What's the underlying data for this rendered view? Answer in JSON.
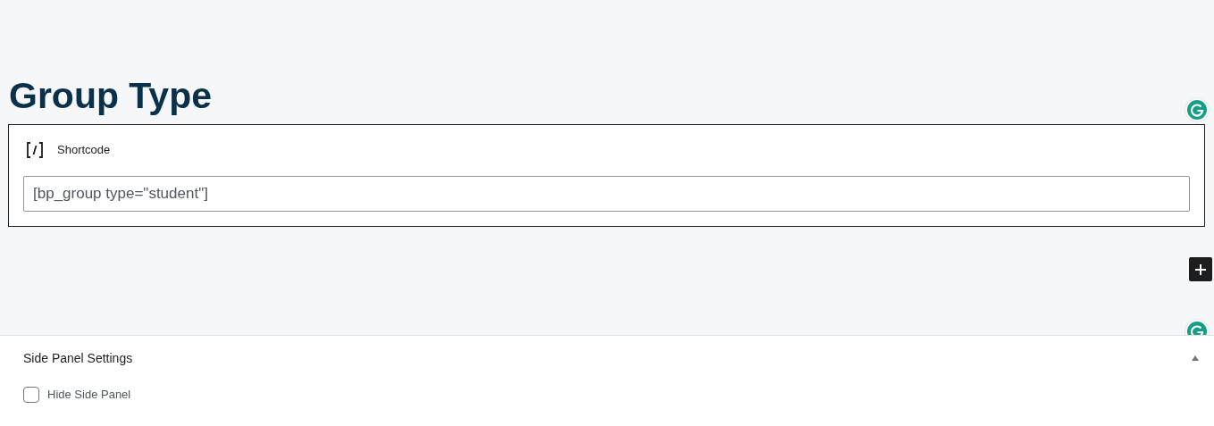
{
  "page_title": "Group Type",
  "block": {
    "label": "Shortcode",
    "value": "[bp_group type=\"student\"]"
  },
  "side_panel": {
    "title": "Side Panel Settings",
    "expanded": true,
    "options": [
      {
        "label": "Hide Side Panel",
        "checked": false
      }
    ]
  }
}
